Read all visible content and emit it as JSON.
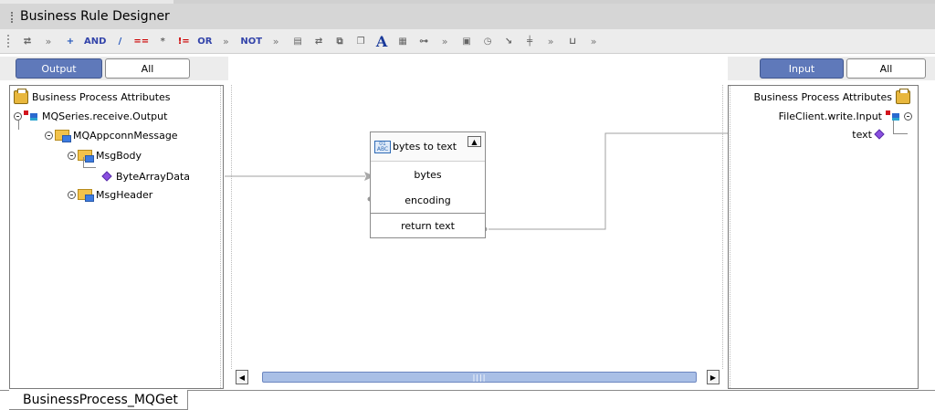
{
  "window": {
    "title": "Business Rule Designer"
  },
  "toolbar": {
    "items": [
      {
        "icon": "arrow-rule-icon",
        "label": "⮂"
      },
      {
        "icon": "more-icon",
        "label": "»"
      },
      {
        "icon": "add-icon",
        "label": "+"
      },
      {
        "icon": "and-icon",
        "label": "AND"
      },
      {
        "icon": "slash-icon",
        "label": "/"
      },
      {
        "icon": "equals-icon",
        "label": "=="
      },
      {
        "icon": "asterisk-icon",
        "label": "*"
      },
      {
        "icon": "not-equals-icon",
        "label": "!="
      },
      {
        "icon": "or-icon",
        "label": "OR"
      },
      {
        "icon": "more-icon",
        "label": "»"
      },
      {
        "icon": "not-icon",
        "label": "NOT"
      },
      {
        "icon": "more-icon",
        "label": "»"
      },
      {
        "icon": "convert-icon",
        "label": "▤"
      },
      {
        "icon": "link-icon",
        "label": "⇄"
      },
      {
        "icon": "copy-icon",
        "label": "⧉"
      },
      {
        "icon": "paste-icon",
        "label": "❐"
      },
      {
        "icon": "text-icon",
        "label": "A"
      },
      {
        "icon": "abc-icon",
        "label": "▦"
      },
      {
        "icon": "chain-icon",
        "label": "⊶"
      },
      {
        "icon": "more-icon",
        "label": "»"
      },
      {
        "icon": "table-icon",
        "label": "▣"
      },
      {
        "icon": "clock-icon",
        "label": "◷"
      },
      {
        "icon": "id-icon",
        "label": "↘"
      },
      {
        "icon": "split-icon",
        "label": "╪"
      },
      {
        "icon": "more-icon",
        "label": "»"
      },
      {
        "icon": "length-icon",
        "label": "⊔"
      },
      {
        "icon": "more-icon",
        "label": "»"
      }
    ]
  },
  "output_tabs": {
    "active": "Output",
    "inactive": "All"
  },
  "input_tabs": {
    "active": "Input",
    "inactive": "All"
  },
  "left_tree": {
    "root": "Business Process Attributes",
    "mq_output": "MQSeries.receive.Output",
    "mq_conn": "MQAppconnMessage",
    "msg_body": "MsgBody",
    "byte_array": "ByteArrayData",
    "msg_header": "MsgHeader"
  },
  "right_tree": {
    "root": "Business Process Attributes",
    "file_input": "FileClient.write.Input",
    "text": "text"
  },
  "method_box": {
    "title": "bytes to text",
    "params": [
      "bytes",
      "encoding"
    ],
    "result": "return text"
  },
  "scrollbar": {
    "thumb_grip": "||||"
  },
  "bottom_tab": {
    "label": "BusinessProcess_MQGet"
  },
  "colors": {
    "accent": "#5f79ba",
    "panel_border": "#7a7a7a",
    "connector": "#9e9e9e",
    "diamond": "#8a4fe0"
  }
}
